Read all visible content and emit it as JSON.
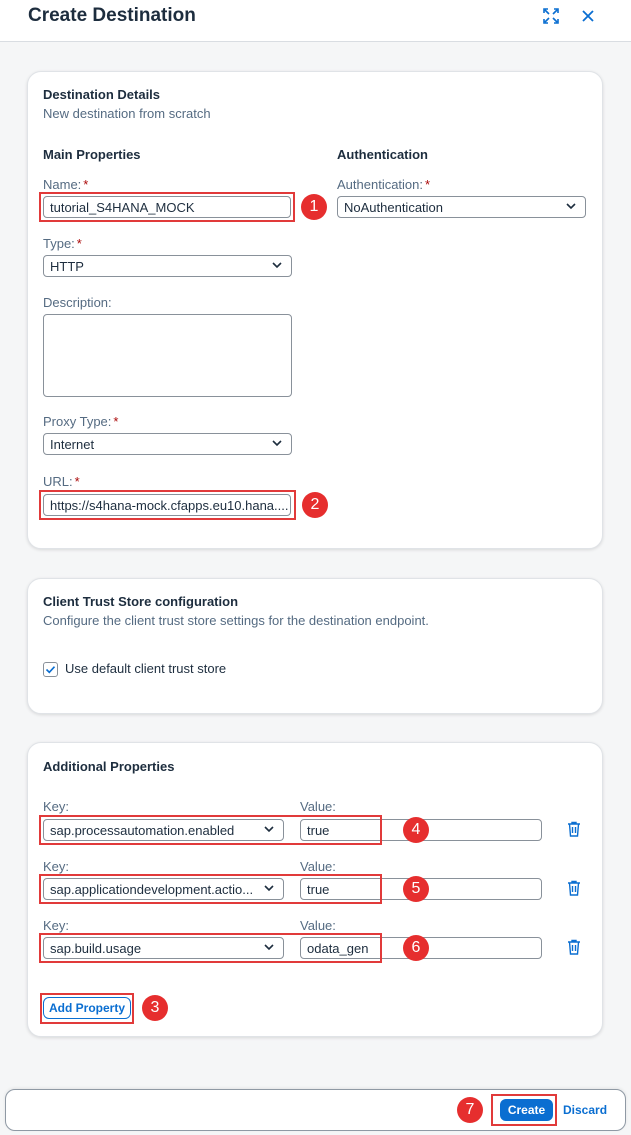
{
  "header": {
    "title": "Create Destination"
  },
  "details": {
    "title": "Destination Details",
    "subtitle": "New destination from scratch",
    "main_heading": "Main Properties",
    "auth_heading": "Authentication",
    "name_label": "Name:",
    "name_value": "tutorial_S4HANA_MOCK",
    "type_label": "Type:",
    "type_value": "HTTP",
    "description_label": "Description:",
    "proxy_label": "Proxy Type:",
    "proxy_value": "Internet",
    "url_label": "URL:",
    "url_value": "https://s4hana-mock.cfapps.eu10.hana....",
    "auth_label": "Authentication:",
    "auth_value": "NoAuthentication",
    "required_mark": "*"
  },
  "trust": {
    "title": "Client Trust Store configuration",
    "subtitle": "Configure the client trust store settings for the destination endpoint.",
    "checkbox_label": "Use default client trust store"
  },
  "additional": {
    "title": "Additional Properties",
    "key_label": "Key:",
    "value_label": "Value:",
    "rows": [
      {
        "key": "sap.processautomation.enabled",
        "value": "true"
      },
      {
        "key": "sap.applicationdevelopment.actio...",
        "value": "true"
      },
      {
        "key": "sap.build.usage",
        "value": "odata_gen"
      }
    ],
    "add_label": "Add Property"
  },
  "footer": {
    "create_label": "Create",
    "discard_label": "Discard"
  },
  "badges": [
    "1",
    "2",
    "3",
    "4",
    "5",
    "6",
    "7"
  ],
  "colors": {
    "accent": "#0a6ed1",
    "annotation_red": "#e62e2e",
    "required": "#aa0808"
  }
}
